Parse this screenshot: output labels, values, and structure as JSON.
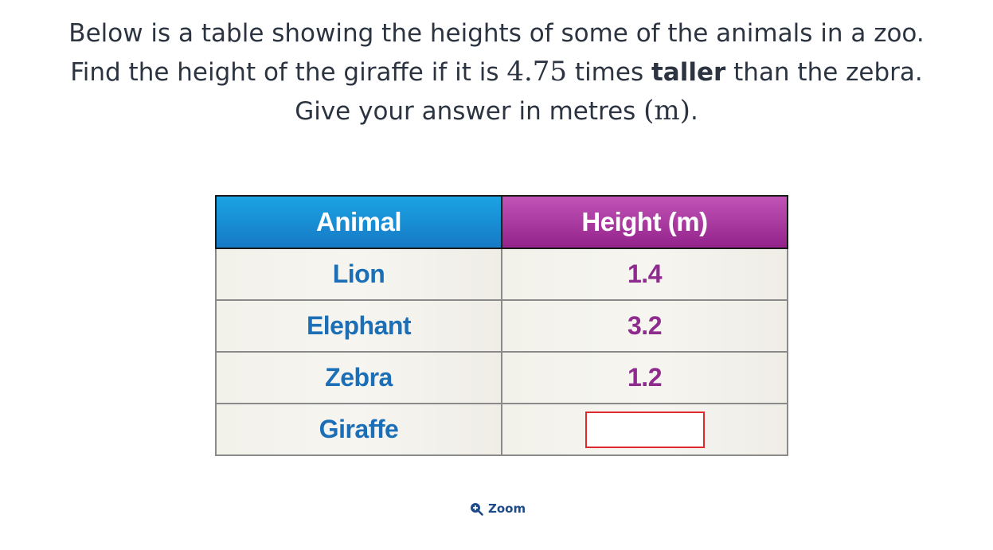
{
  "question": {
    "line1": "Below is a table showing the heights of some of the animals in a zoo.",
    "line2_pre": "Find the height of the giraffe if it is ",
    "line2_factor": "4.75",
    "line2_mid": " times ",
    "line2_bold": "taller",
    "line2_post": " than the zebra.",
    "line3_pre": "Give your answer in metres ",
    "line3_unit": "(m)",
    "line3_post": "."
  },
  "table": {
    "headers": [
      "Animal",
      "Height (m)"
    ],
    "rows": [
      {
        "animal": "Lion",
        "height": "1.4"
      },
      {
        "animal": "Elephant",
        "height": "3.2"
      },
      {
        "animal": "Zebra",
        "height": "1.2"
      },
      {
        "animal": "Giraffe",
        "height": ""
      }
    ]
  },
  "zoom": {
    "label": "Zoom",
    "icon": "zoom-in-icon"
  },
  "colors": {
    "header_animal": "#1679c6",
    "header_height": "#93238b",
    "animal_text": "#1c6fb6",
    "height_text": "#8f2a8e",
    "answer_border": "#e0282e"
  }
}
